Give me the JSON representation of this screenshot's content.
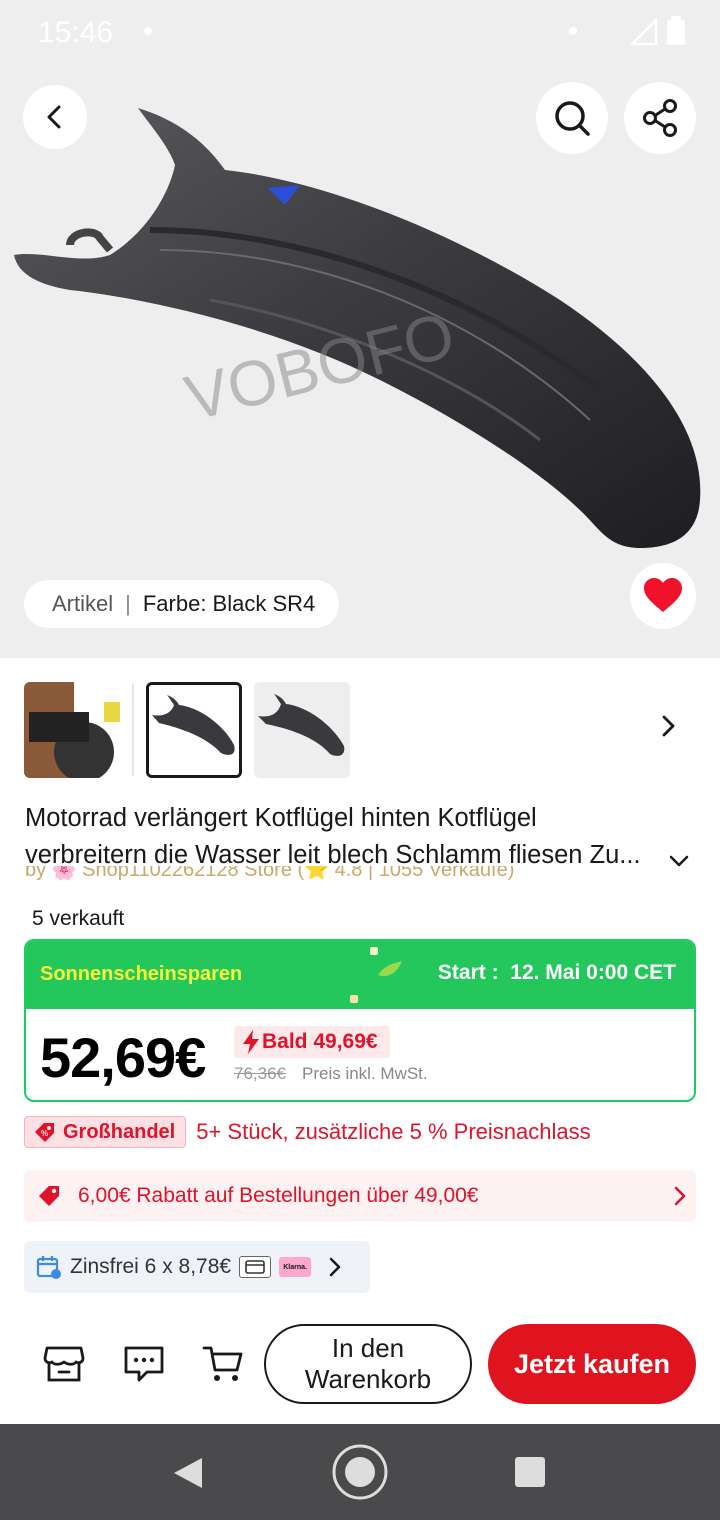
{
  "status_bar": {
    "time": "15:46"
  },
  "gallery": {
    "watermark": "VOBOFO",
    "variant_label": "Artikel",
    "variant_separator": "|",
    "variant_value": "Farbe: Black SR4"
  },
  "product": {
    "title_line1": "Motorrad verlängert Kotflügel hinten Kotflügel",
    "title_line2": "verbreitern die Wasser leit blech Schlamm fliesen Zu...",
    "store_line_partial": "by 🌸 Shop1102262128 Store (⭐ 4.8 | 1055 Verkäufe)",
    "sold": "5 verkauft"
  },
  "promo": {
    "name": "Sonnenscheinsparen",
    "start_label": "Start :",
    "start_value": "12. Mai 0:00 CET",
    "price": "52,69€",
    "soon_price": "Bald 49,69€",
    "old_price": "76,36€",
    "tax_note": "Preis inkl. MwSt."
  },
  "bulk": {
    "badge": "Großhandel",
    "text": "5+ Stück, zusätzliche 5 % Preisnachlass"
  },
  "coupon": {
    "text": "6,00€ Rabatt auf Bestellungen über 49,00€"
  },
  "installment": {
    "text": "Zinsfrei 6 x 8,78€",
    "klarna": "Klarna."
  },
  "actions": {
    "add_to_cart": "In den Warenkorb",
    "buy_now": "Jetzt kaufen"
  },
  "colors": {
    "accent_red": "#e0141e",
    "promo_green": "#24c75c",
    "promo_yellow": "#f4f83a"
  },
  "icons": [
    "back-icon",
    "search-icon",
    "share-icon",
    "heart-icon",
    "chevron-right-icon",
    "chevron-down-icon",
    "lightning-icon",
    "tag-icon",
    "coupon-icon",
    "calendar-icon",
    "card-icon",
    "store-icon",
    "chat-icon",
    "cart-icon"
  ]
}
